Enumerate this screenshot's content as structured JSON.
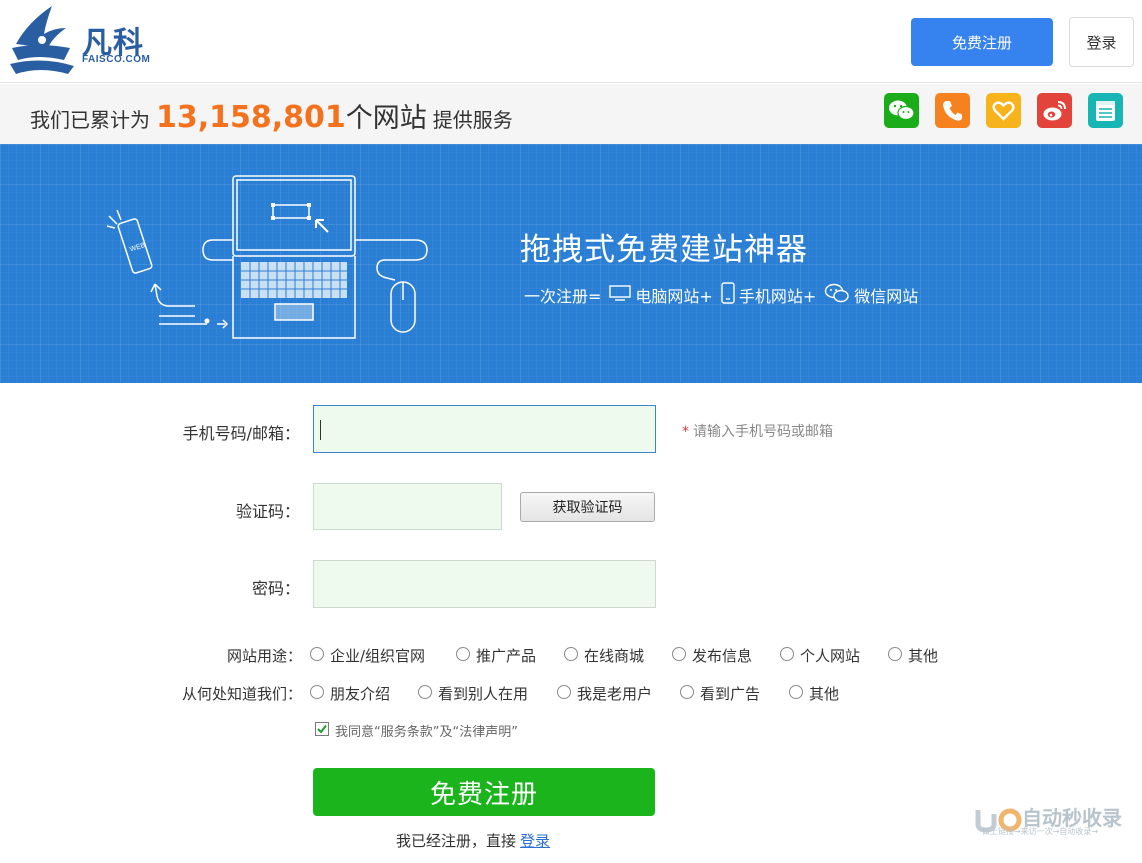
{
  "header": {
    "logo_name": "凡科",
    "logo_domain": "FAISCO.COM",
    "register_label": "免费注册",
    "login_label": "登录"
  },
  "stats": {
    "prefix": "我们已累计为",
    "count": "13,158,801",
    "unit": "个网站",
    "suffix": "提供服务"
  },
  "social_icons": [
    {
      "name": "wechat-icon",
      "color": "#1aad19"
    },
    {
      "name": "phone-icon",
      "color": "#f5821f"
    },
    {
      "name": "heart-icon",
      "color": "#f6b31b"
    },
    {
      "name": "weibo-icon",
      "color": "#e2433b"
    },
    {
      "name": "notepad-icon",
      "color": "#17b6b4"
    }
  ],
  "banner": {
    "title": "拖拽式免费建站神器",
    "sub_prefix": "一次注册=",
    "sub_pc": "电脑网站+",
    "sub_mobile": "手机网站+",
    "sub_wechat": "微信网站",
    "phone_badge": "WEB",
    "bg_color": "#2a7fd4"
  },
  "form": {
    "account_label": "手机号码/邮箱：",
    "account_value": "",
    "account_hint": "请输入手机号码或邮箱",
    "code_label": "验证码：",
    "code_value": "",
    "get_code_label": "获取验证码",
    "password_label": "密码：",
    "password_value": "",
    "purpose_label": "网站用途：",
    "purpose_options": [
      "企业/组织官网",
      "推广产品",
      "在线商城",
      "发布信息",
      "个人网站",
      "其他"
    ],
    "source_label": "从何处知道我们：",
    "source_options": [
      "朋友介绍",
      "看到别人在用",
      "我是老用户",
      "看到广告",
      "其他"
    ],
    "agree_text": "我同意“服务条款”及“法律声明”",
    "agree_checked": true,
    "submit_label": "免费注册",
    "already_text": "我已经注册，直接",
    "login_link": "登录"
  },
  "watermark": {
    "text": "自动秒收录",
    "sub": "做上链接→来访一次→自动收录→"
  }
}
